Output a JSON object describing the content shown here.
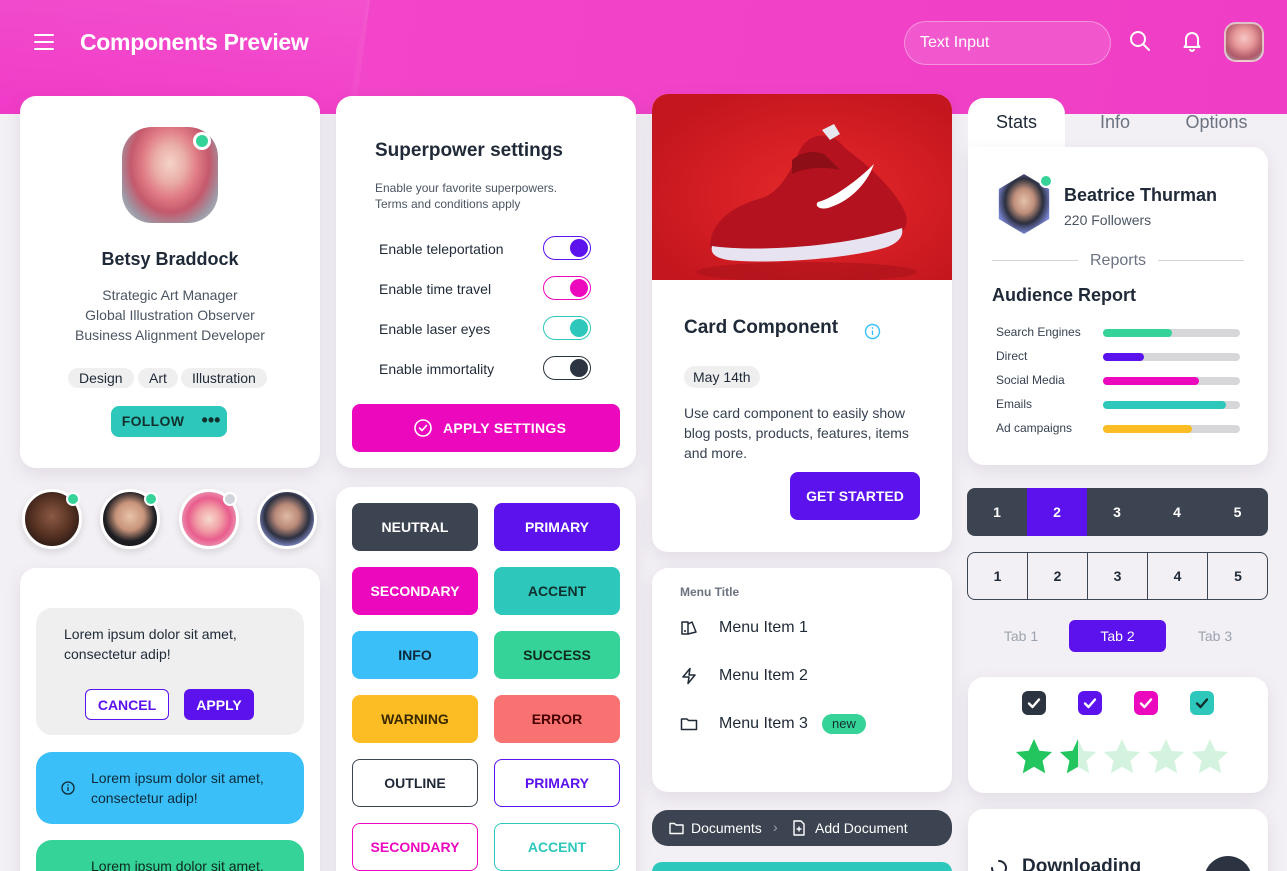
{
  "header": {
    "title": "Components Preview",
    "search_placeholder": "Text Input",
    "menu_icon": "hamburger-icon",
    "search_icon": "search-icon",
    "bell_icon": "bell-icon"
  },
  "profile": {
    "name": "Betsy Braddock",
    "roles": [
      "Strategic Art Manager",
      "Global Illustration Observer",
      "Business Alignment Developer"
    ],
    "tags": [
      "Design",
      "Art",
      "Illustration"
    ],
    "follow_label": "FOLLOW",
    "more_label": "•••"
  },
  "alerts": {
    "dialog_text": "Lorem ipsum dolor sit amet, consectetur adip!",
    "cancel_label": "CANCEL",
    "apply_label": "APPLY",
    "info_text": "Lorem ipsum dolor sit amet, consectetur adip!",
    "success_text": "Lorem ipsum dolor sit amet, consectetur adip!"
  },
  "superpower": {
    "title": "Superpower settings",
    "desc_line1": "Enable your favorite superpowers.",
    "desc_line2": "Terms and conditions apply",
    "settings": [
      {
        "label": "Enable teleportation",
        "color": "#5b12ec"
      },
      {
        "label": "Enable time travel",
        "color": "#ec08bd"
      },
      {
        "label": "Enable laser eyes",
        "color": "#2dc8bb"
      },
      {
        "label": "Enable immortality",
        "color": "#2b3440"
      }
    ],
    "apply_label": "APPLY SETTINGS"
  },
  "buttons": {
    "neutral": "NEUTRAL",
    "primary": "PRIMARY",
    "secondary": "SECONDARY",
    "accent": "ACCENT",
    "info": "INFO",
    "success": "SUCCESS",
    "warning": "WARNING",
    "error": "ERROR",
    "outline": "OUTLINE",
    "outline_primary": "PRIMARY",
    "outline_secondary": "SECONDARY",
    "outline_accent": "ACCENT"
  },
  "card": {
    "title": "Card Component",
    "date": "May 14th",
    "text": "Use card component to easily show blog posts, products, features, items and more.",
    "cta": "GET STARTED"
  },
  "menu": {
    "title": "Menu Title",
    "items": [
      "Menu Item 1",
      "Menu Item 2",
      "Menu Item 3"
    ],
    "badge": "new"
  },
  "breadcrumb": {
    "items": [
      "Documents",
      "Add Document"
    ]
  },
  "stats": {
    "tabs": [
      "Stats",
      "Info",
      "Options"
    ],
    "user_name": "Beatrice Thurman",
    "followers": "220 Followers",
    "reports_label": "Reports",
    "report_title": "Audience Report",
    "bars": [
      {
        "label": "Search Engines",
        "value": 0.5,
        "color": "#36d399"
      },
      {
        "label": "Direct",
        "value": 0.3,
        "color": "#5b12ec"
      },
      {
        "label": "Social Media",
        "value": 0.7,
        "color": "#ec08bd"
      },
      {
        "label": "Emails",
        "value": 0.9,
        "color": "#2dc8bb"
      },
      {
        "label": "Ad campaigns",
        "value": 0.65,
        "color": "#fbbd23"
      }
    ]
  },
  "pagination": {
    "pages": [
      "1",
      "2",
      "3",
      "4",
      "5"
    ],
    "active": "2"
  },
  "tabs2": {
    "items": [
      "Tab 1",
      "Tab 2",
      "Tab 3"
    ],
    "active": "Tab 2"
  },
  "checkboxes": {
    "colors": [
      "#2b3440",
      "#5b12ec",
      "#ec08bd",
      "#2dc8bb"
    ]
  },
  "rating": {
    "value": 1.5,
    "max": 5,
    "color": "#22c55e"
  },
  "download": {
    "title": "Downloading"
  }
}
